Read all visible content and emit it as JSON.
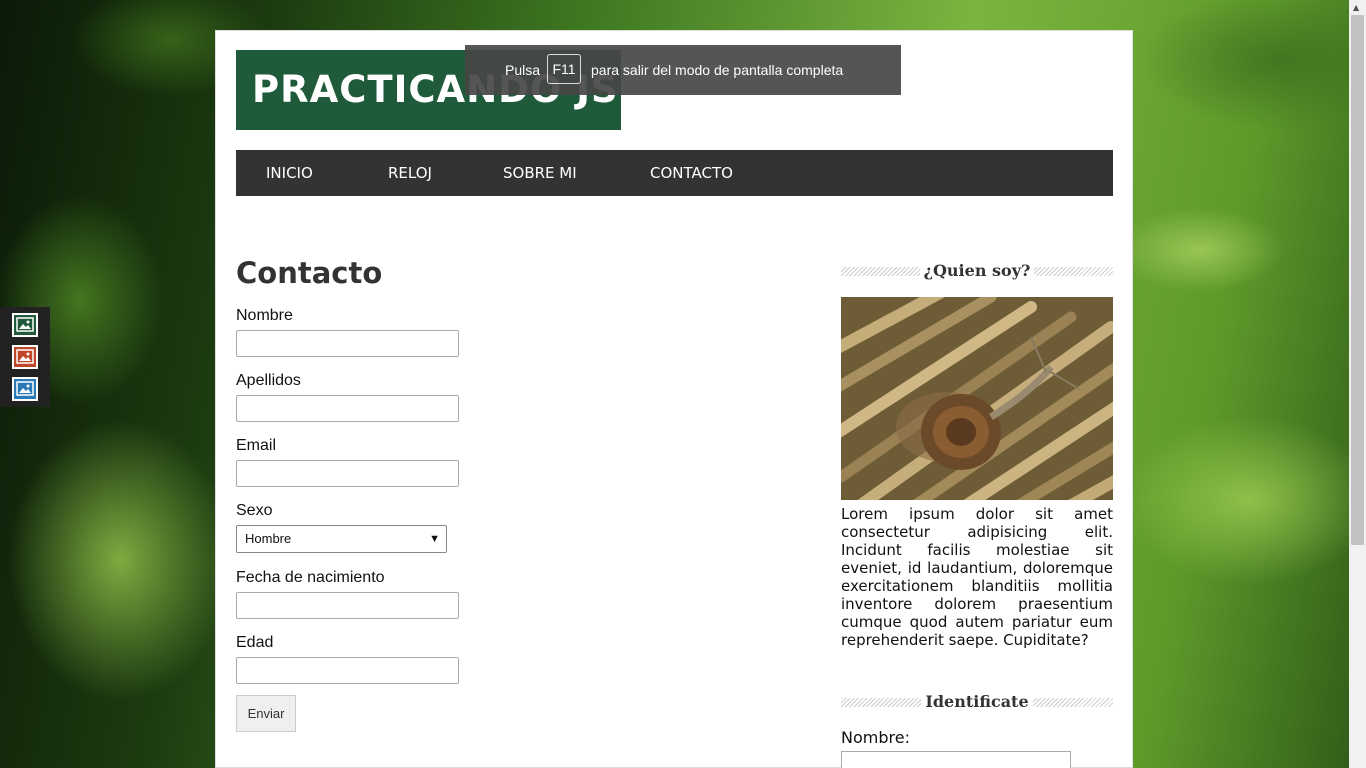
{
  "site": {
    "logo_text": "PRACTICANDO JS"
  },
  "fullscreen_notice": {
    "before_key": "Pulsa",
    "key": "F11",
    "after_key": "para salir del modo de pantalla completa"
  },
  "nav": {
    "items": [
      {
        "label": "INICIO"
      },
      {
        "label": "RELOJ"
      },
      {
        "label": "SOBRE MI"
      },
      {
        "label": "CONTACTO"
      }
    ]
  },
  "main": {
    "title": "Contacto",
    "form": {
      "nombre_label": "Nombre",
      "nombre_value": "",
      "apellidos_label": "Apellidos",
      "apellidos_value": "",
      "email_label": "Email",
      "email_value": "",
      "sexo_label": "Sexo",
      "sexo_selected": "Hombre",
      "fecha_label": "Fecha de nacimiento",
      "fecha_value": "",
      "edad_label": "Edad",
      "edad_value": "",
      "submit_label": "Enviar"
    }
  },
  "sidebar": {
    "about_title": "¿Quien soy?",
    "about_text": "Lorem ipsum dolor sit amet consectetur adipisicing elit. Incidunt facilis molestiae sit eveniet, id laudantium, doloremque exercitationem blanditiis mollitia inventore dolorem praesentium cumque quod autem pariatur eum reprehenderit saepe. Cupiditate?",
    "identify_title": "Identificate",
    "nombre_label": "Nombre:",
    "nombre_value": ""
  },
  "side_icons": [
    {
      "icon": "image-icon",
      "color": "#1f5b3a"
    },
    {
      "icon": "image-icon",
      "color": "#c0462a"
    },
    {
      "icon": "image-icon",
      "color": "#2a7ab8"
    }
  ],
  "colors": {
    "logo_bg": "#1f5b3a",
    "nav_bg": "#333333",
    "notice_bg": "#464646"
  }
}
